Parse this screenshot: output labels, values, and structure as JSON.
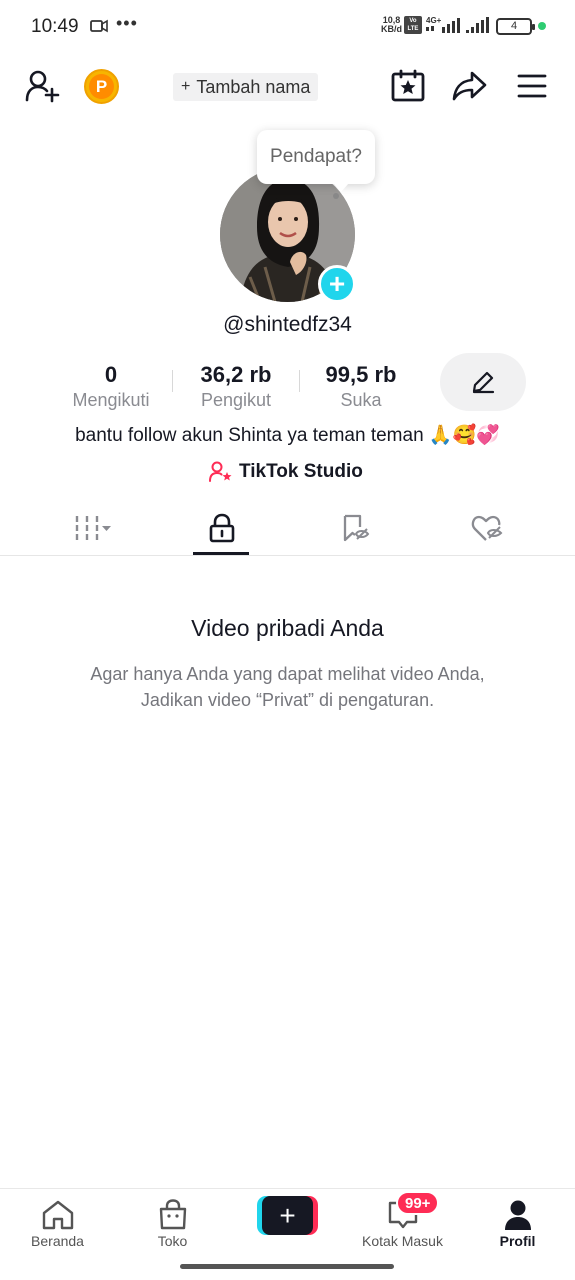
{
  "status_bar": {
    "time": "10:49",
    "dots": "•••",
    "net_speed_value": "10,8",
    "net_speed_unit": "KB/d",
    "volte_top": "Vo",
    "volte_bottom": "LTE",
    "network": "4G+",
    "battery": "4",
    "battery_dot_color": "#2ecc71"
  },
  "header": {
    "add_friend_icon": "add-user-icon",
    "points_label": "P",
    "add_name_plus": "+",
    "add_name_label": "Tambah nama",
    "calendar_icon": "calendar-star-icon",
    "share_icon": "share-icon",
    "menu_icon": "menu-icon"
  },
  "profile": {
    "bubble_text": "Pendapat?",
    "avatar_add": "+",
    "username": "@shintedfz34",
    "stats": [
      {
        "value": "0",
        "label": "Mengikuti"
      },
      {
        "value": "36,2 rb",
        "label": "Pengikut"
      },
      {
        "value": "99,5 rb",
        "label": "Suka"
      }
    ],
    "bio": "bantu follow akun Shinta ya teman teman 🙏🥰💞",
    "studio_label": "TikTok Studio"
  },
  "tabs": [
    {
      "icon": "grid-icon",
      "active": false
    },
    {
      "icon": "lock-icon",
      "active": true
    },
    {
      "icon": "bookmark-hidden-icon",
      "active": false
    },
    {
      "icon": "heart-hidden-icon",
      "active": false
    }
  ],
  "empty_state": {
    "title": "Video pribadi Anda",
    "line1": "Agar hanya Anda yang dapat melihat video Anda,",
    "line2": "Jadikan video “Privat” di pengaturan."
  },
  "bottom_nav": {
    "items": [
      {
        "label": "Beranda",
        "icon": "home-icon"
      },
      {
        "label": "Toko",
        "icon": "shopping-bag-icon"
      },
      {
        "label": "",
        "icon": "plus-icon"
      },
      {
        "label": "Kotak Masuk",
        "icon": "inbox-icon"
      },
      {
        "label": "Profil",
        "icon": "profile-icon"
      }
    ],
    "create_plus": "+",
    "inbox_badge": "99+"
  },
  "colors": {
    "accent_cyan": "#20d5ec",
    "accent_red": "#fe2c55",
    "text_primary": "#161823",
    "text_secondary": "#8a8b91"
  }
}
